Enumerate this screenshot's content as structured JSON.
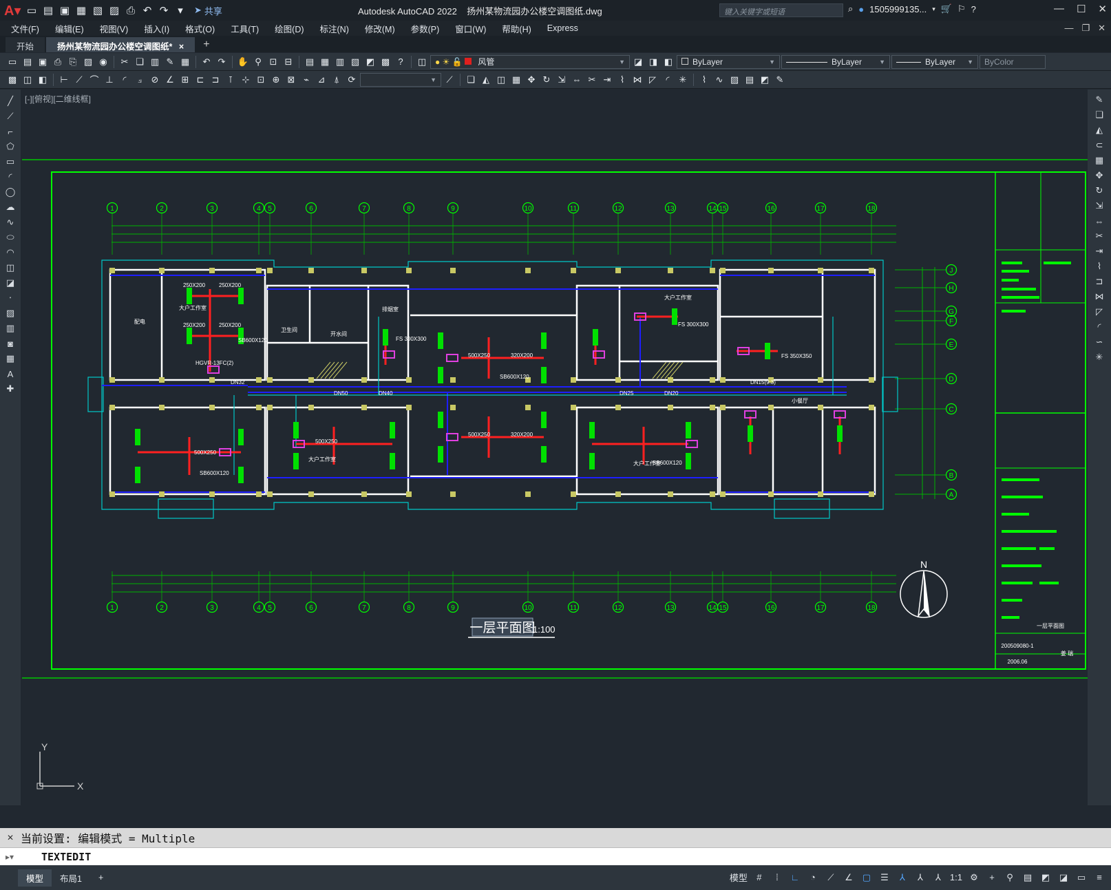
{
  "titlebar": {
    "app_title": "Autodesk AutoCAD 2022",
    "file_name": "扬州某物流园办公楼空调图纸.dwg",
    "share_label": "共享",
    "search_placeholder": "键入关键字或短语",
    "user_name": "1505999135..."
  },
  "menu": {
    "items": [
      "文件(F)",
      "编辑(E)",
      "视图(V)",
      "插入(I)",
      "格式(O)",
      "工具(T)",
      "绘图(D)",
      "标注(N)",
      "修改(M)",
      "参数(P)",
      "窗口(W)",
      "帮助(H)",
      "Express"
    ]
  },
  "tabs": {
    "start": "开始",
    "active": "扬州某物流园办公楼空调图纸*",
    "close": "×",
    "add": "+"
  },
  "properties": {
    "layer_name": "风管",
    "layer_color": "#e0201e",
    "color_value": "ByLayer",
    "linetype_value": "ByLayer",
    "lineweight_value": "ByLayer",
    "plotstyle_value": "ByColor"
  },
  "viewport": {
    "label": "[-][俯视][二维线框]"
  },
  "drawing": {
    "title": "一层平面图",
    "scale": "1:100",
    "north": "N",
    "axis_top": [
      "1",
      "2",
      "3",
      "4",
      "5",
      "6",
      "7",
      "8",
      "9",
      "10",
      "11",
      "12",
      "13",
      "14",
      "15",
      "16",
      "17",
      "18"
    ],
    "axis_right": [
      "J",
      "H",
      "G",
      "F",
      "E",
      "D",
      "C",
      "B",
      "A"
    ],
    "rooms": [
      "大户工作室",
      "大户工作室",
      "大户工作室",
      "大户工作室",
      "排烟室",
      "卫生间",
      "开水间",
      "配电",
      "小餐厅"
    ],
    "duct_labels": [
      "250X200",
      "250X200",
      "250X200",
      "250X200",
      "500X250",
      "500X250",
      "500X250",
      "500X250",
      "320X200",
      "320X200",
      "SB600X120",
      "SB600X120",
      "SB600X120",
      "SB600X120",
      "HGVR-13FC(2)",
      "FS 300X300",
      "FS 300X300",
      "FS 350X350"
    ],
    "pipe_labels": [
      "DN32",
      "DN25",
      "DN40",
      "DN50",
      "DN20",
      "DN15(9.3)"
    ],
    "titleblock_number": "200509080-1",
    "titleblock_date": "2006.06",
    "titleblock_sheet": "一层平面图",
    "titleblock_author": "姜 瑞",
    "colors": {
      "frame": "#00ff00",
      "wall": "#ffffff",
      "water_pipe": "#1e1eff",
      "duct": "#ff2020",
      "column": "#c8c864",
      "grid": "#00b400",
      "cyan": "#00c8c8",
      "magenta": "#e040e0"
    }
  },
  "ucs": {
    "x": "X",
    "y": "Y"
  },
  "command": {
    "history": "当前设置: 编辑模式 = Multiple",
    "input": "TEXTEDIT"
  },
  "status": {
    "tab_model": "模型",
    "tab_layout": "布局1",
    "model_label": "模型",
    "scale": "1:1"
  }
}
